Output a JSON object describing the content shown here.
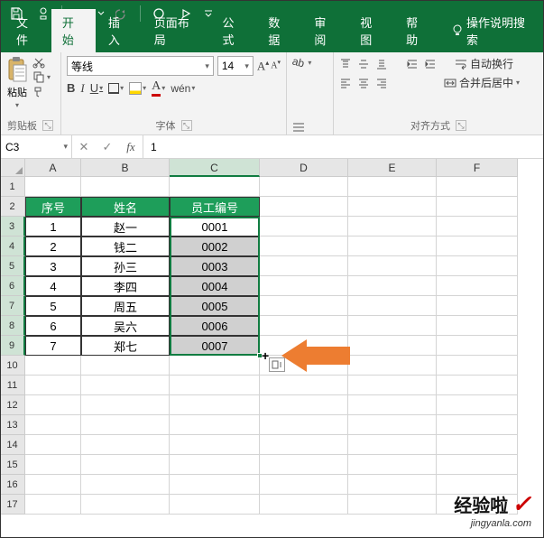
{
  "titlebar": {
    "save": "保存",
    "undo": "撤消",
    "redo": "恢复"
  },
  "tabs": {
    "file": "文件",
    "home": "开始",
    "insert": "插入",
    "layout": "页面布局",
    "formulas": "公式",
    "data": "数据",
    "review": "审阅",
    "view": "视图",
    "help": "帮助",
    "tellme": "操作说明搜索"
  },
  "ribbon": {
    "clipboard": {
      "paste": "粘贴",
      "group": "剪贴板"
    },
    "font": {
      "name": "等线",
      "size": "14",
      "group": "字体",
      "bold": "B",
      "italic": "I",
      "underline": "U",
      "wen": "wén"
    },
    "align": {
      "wrap": "自动换行",
      "merge": "合并后居中",
      "group": "对齐方式"
    }
  },
  "formula_bar": {
    "name": "C3",
    "value": "1"
  },
  "columns": {
    "A": "A",
    "B": "B",
    "C": "C",
    "D": "D",
    "E": "E",
    "F": "F"
  },
  "colw": {
    "A": 62,
    "B": 98,
    "C": 100,
    "D": 98,
    "E": 98,
    "F": 90
  },
  "rows": [
    "1",
    "2",
    "3",
    "4",
    "5",
    "6",
    "7",
    "8",
    "9",
    "10",
    "11",
    "12",
    "13",
    "14",
    "15",
    "16",
    "17"
  ],
  "headers": {
    "seq": "序号",
    "name": "姓名",
    "emp": "员工编号"
  },
  "data": [
    {
      "seq": "1",
      "name": "赵一",
      "emp": "0001"
    },
    {
      "seq": "2",
      "name": "钱二",
      "emp": "0002"
    },
    {
      "seq": "3",
      "name": "孙三",
      "emp": "0003"
    },
    {
      "seq": "4",
      "name": "李四",
      "emp": "0004"
    },
    {
      "seq": "5",
      "name": "周五",
      "emp": "0005"
    },
    {
      "seq": "6",
      "name": "吴六",
      "emp": "0006"
    },
    {
      "seq": "7",
      "name": "郑七",
      "emp": "0007"
    }
  ],
  "watermark": {
    "text": "经验啦",
    "url": "jingyanla.com"
  }
}
